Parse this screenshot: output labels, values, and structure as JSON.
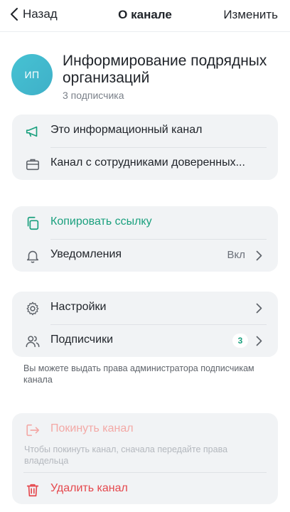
{
  "topbar": {
    "back_label": "Назад",
    "title": "О канале",
    "edit_label": "Изменить"
  },
  "channel": {
    "avatar_initials": "ИП",
    "name": "Информирование подрядных организаций",
    "subscribers": "3 подписчика"
  },
  "info": {
    "type_label": "Это информационный канал",
    "members_label": "Канал с сотрудниками доверенных..."
  },
  "actions": {
    "copy_link": "Копировать ссылку",
    "notifications_label": "Уведомления",
    "notifications_value": "Вкл"
  },
  "manage": {
    "settings_label": "Настройки",
    "subscribers_label": "Подписчики",
    "subscribers_count": "3",
    "hint": "Вы можете выдать права администратора подписчикам канала"
  },
  "danger": {
    "leave_label": "Покинуть канал",
    "leave_hint": "Чтобы покинуть канал, сначала передайте права владельца",
    "delete_label": "Удалить канал"
  },
  "colors": {
    "accent": "#1aa07e",
    "danger": "#e5484d",
    "disabled": "#f3a9a6",
    "card_bg": "#f1f3f5"
  }
}
